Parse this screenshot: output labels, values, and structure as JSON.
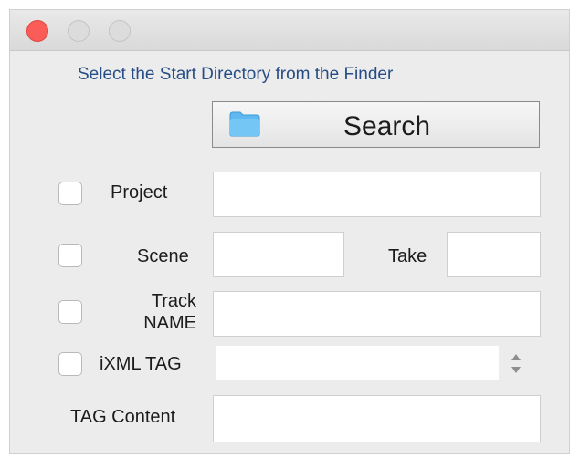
{
  "window": {
    "instruction": "Select the Start Directory from the Finder"
  },
  "search_button": {
    "label": "Search",
    "icon": "folder-icon"
  },
  "fields": {
    "project": {
      "label": "Project",
      "value": ""
    },
    "scene": {
      "label": "Scene",
      "value": ""
    },
    "take": {
      "label": "Take",
      "value": ""
    },
    "track_name": {
      "label_line1": "Track",
      "label_line2": "NAME",
      "value": ""
    },
    "ixml_tag": {
      "label": "iXML TAG",
      "value": ""
    },
    "tag_content": {
      "label": "TAG Content",
      "value": ""
    }
  },
  "colors": {
    "accent_text": "#264d86",
    "close": "#fc5c57",
    "folder": "#5fb8ef"
  }
}
